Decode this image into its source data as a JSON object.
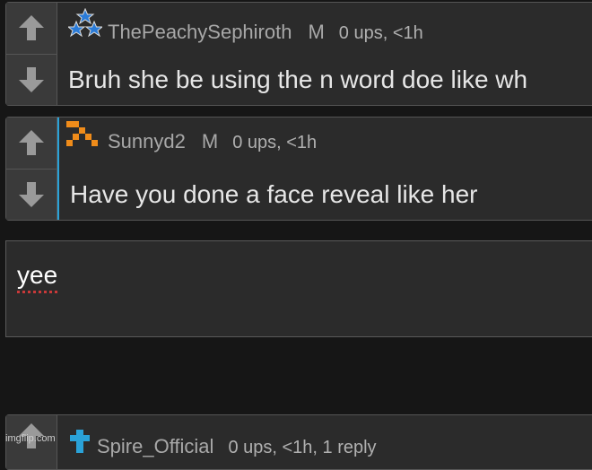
{
  "comments": [
    {
      "username": "ThePeachySephiroth",
      "gender": "M",
      "stats": "0 ups, <1h",
      "text": "Bruh she be using the n word doe like wh"
    },
    {
      "username": "Sunnyd2",
      "gender": "M",
      "stats": "0 ups, <1h",
      "text": "Have you done a face reveal like her"
    },
    {
      "username": "Spire_Official",
      "stats": "0 ups, <1h, 1 reply"
    }
  ],
  "reply": {
    "value": "yee"
  },
  "watermark": "imgflip.com",
  "colors": {
    "accent": "#2aa2d8",
    "orange": "#f08c1a",
    "star": "#2a7bd8"
  }
}
